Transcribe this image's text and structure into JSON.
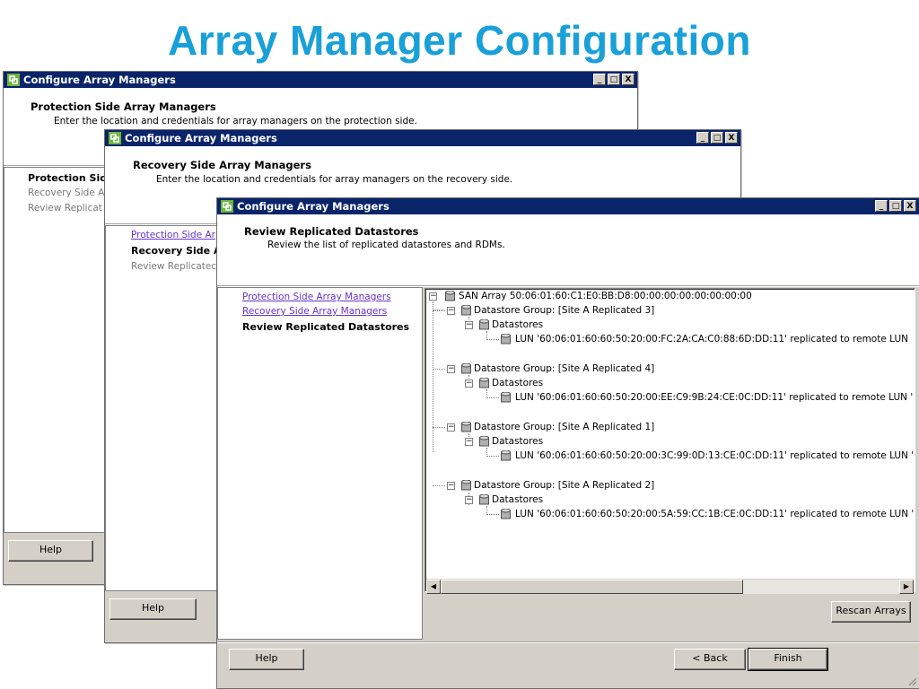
{
  "slide_title": "Array Manager Configuration",
  "window_title": "Configure Array Managers",
  "window_buttons": {
    "minimize": "_",
    "maximize": "□",
    "close": "X"
  },
  "w1": {
    "header_title": "Protection Side Array Managers",
    "header_sub": "Enter the location and credentials for array managers on the protection side.",
    "nav": [
      "Protection Sic",
      "Recovery Side A",
      "Review Replicat"
    ],
    "help": "Help"
  },
  "w2": {
    "header_title": "Recovery Side Array Managers",
    "header_sub": "Enter the location and credentials for array managers on the recovery side.",
    "nav": [
      "Protection Side Ar",
      "Recovery Side A",
      "Review Replicatec"
    ],
    "help": "Help"
  },
  "w3": {
    "header_title": "Review Replicated Datastores",
    "header_sub": "Review the list of replicated datastores and RDMs.",
    "nav": [
      "Protection Side Array Managers",
      "Recovery Side Array Managers",
      "Review Replicated Datastores"
    ],
    "tree": {
      "root": "SAN Array 50:06:01:60:C1:E0:BB:D8:00:00:00:00:00:00:00:00",
      "groups": [
        {
          "label": "Datastore Group: [Site A Replicated 3]",
          "folder": "Datastores",
          "lun": "LUN '60:06:01:60:60:50:20:00:FC:2A:CA:C0:88:6D:DD:11' replicated to remote LUN"
        },
        {
          "label": "Datastore Group: [Site A Replicated 4]",
          "folder": "Datastores",
          "lun": "LUN '60:06:01:60:60:50:20:00:EE:C9:9B:24:CE:0C:DD:11' replicated to remote LUN '"
        },
        {
          "label": "Datastore Group: [Site A Replicated 1]",
          "folder": "Datastores",
          "lun": "LUN '60:06:01:60:60:50:20:00:3C:99:0D:13:CE:0C:DD:11' replicated to remote LUN '"
        },
        {
          "label": "Datastore Group: [Site A Replicated 2]",
          "folder": "Datastores",
          "lun": "LUN '60:06:01:60:60:50:20:00:5A:59:CC:1B:CE:0C:DD:11' replicated to remote LUN '"
        }
      ]
    },
    "rescan": "Rescan Arrays",
    "help": "Help",
    "back": "< Back",
    "finish": "Finish"
  },
  "icons": {
    "app": "vmware-app-icon",
    "datastore": "database-icon",
    "expander": "tree-collapse-icon"
  },
  "colors": {
    "title_blue": "#1aa0d8",
    "titlebar": "#0a246a",
    "link": "#6633cc"
  }
}
